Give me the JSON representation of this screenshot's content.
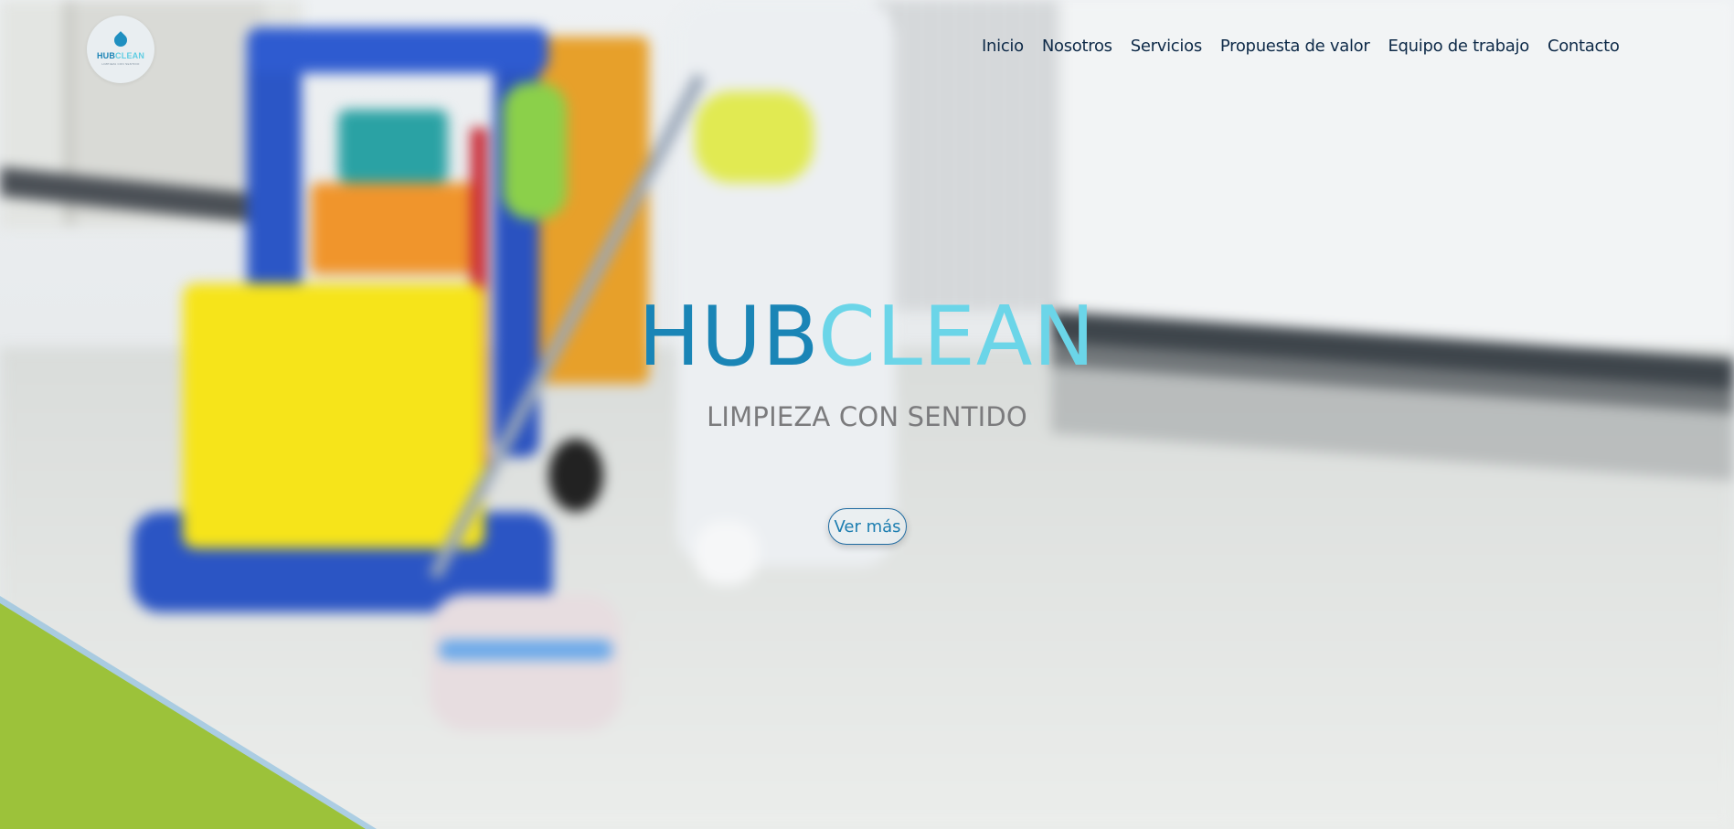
{
  "logo": {
    "hub": "HUB",
    "clean": "CLEAN",
    "tagline": "LIMPIEZA CON SENTIDO"
  },
  "nav": {
    "items": [
      {
        "label": "Inicio"
      },
      {
        "label": "Nosotros"
      },
      {
        "label": "Servicios"
      },
      {
        "label": "Propuesta de valor"
      },
      {
        "label": "Equipo de trabajo"
      },
      {
        "label": "Contacto"
      }
    ]
  },
  "hero": {
    "title_part1": "HUB",
    "title_part2": "CLEAN",
    "subtitle": "LIMPIEZA CON SENTIDO",
    "cta_label": "Ver más"
  },
  "colors": {
    "brand_dark": "#1a85b6",
    "brand_light": "#6bd5e8",
    "nav_text": "#0e2a48",
    "subtitle": "#7b7b7d",
    "accent_green": "#9cc23a"
  },
  "icons": {
    "logo_mark": "water-drop-icon",
    "background": "cleaning-worker-photo"
  }
}
